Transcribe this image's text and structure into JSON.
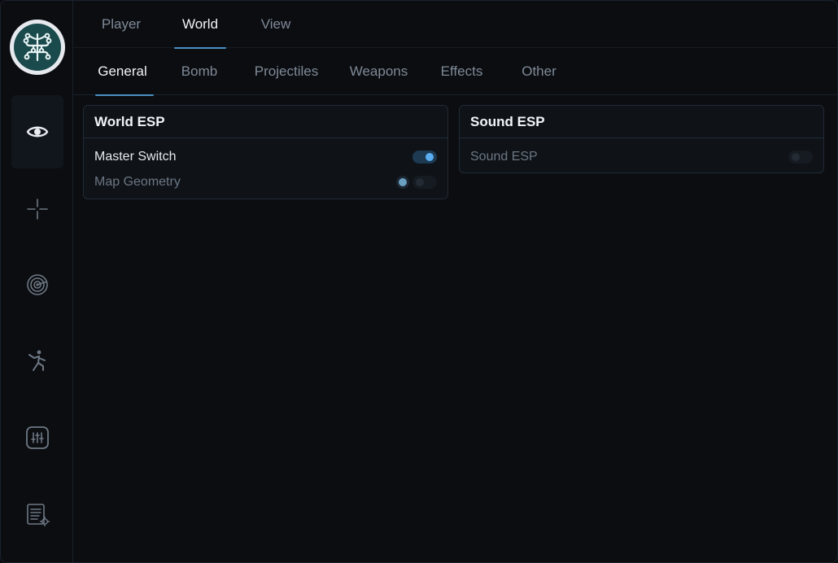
{
  "sidebar": {
    "items": [
      {
        "icon": "eye-icon",
        "active": true
      },
      {
        "icon": "crosshair-icon",
        "active": false
      },
      {
        "icon": "radar-icon",
        "active": false
      },
      {
        "icon": "running-figure-icon",
        "active": false
      },
      {
        "icon": "sliders-icon",
        "active": false
      },
      {
        "icon": "config-list-icon",
        "active": false
      }
    ]
  },
  "top_tabs": [
    {
      "label": "Player",
      "active": false
    },
    {
      "label": "World",
      "active": true
    },
    {
      "label": "View",
      "active": false
    }
  ],
  "sub_tabs": [
    {
      "label": "General",
      "active": true
    },
    {
      "label": "Bomb",
      "active": false
    },
    {
      "label": "Projectiles",
      "active": false
    },
    {
      "label": "Weapons",
      "active": false
    },
    {
      "label": "Effects",
      "active": false
    },
    {
      "label": "Other",
      "active": false
    }
  ],
  "world_esp": {
    "title": "World ESP",
    "master_switch": {
      "label": "Master Switch",
      "enabled": true
    },
    "map_geometry": {
      "label": "Map Geometry",
      "enabled": false,
      "color": "#6a9fc0"
    }
  },
  "sound_esp": {
    "title": "Sound ESP",
    "sound_esp_toggle": {
      "label": "Sound ESP",
      "enabled": false
    }
  },
  "colors": {
    "accent": "#4a8fc4",
    "toggle_on_knob": "#5aaef0",
    "background": "#0b0d11",
    "panel": "#0f1318"
  }
}
